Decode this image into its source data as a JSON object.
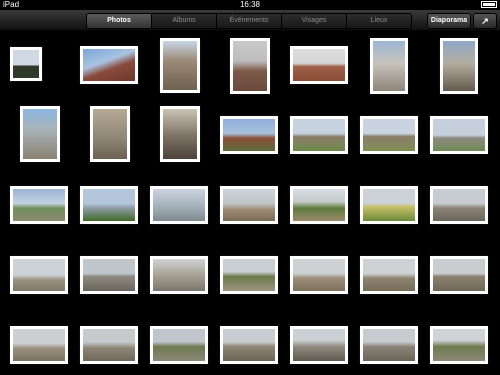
{
  "status": {
    "carrier_icon": "ipad-label",
    "carrier": "iPad",
    "time": "16:38",
    "battery_icon": "battery-icon"
  },
  "toolbar": {
    "tabs": [
      {
        "label": "Photos",
        "active": true
      },
      {
        "label": "Albums",
        "active": false
      },
      {
        "label": "Événements",
        "active": false
      },
      {
        "label": "Visages",
        "active": false
      },
      {
        "label": "Lieux",
        "active": false
      }
    ],
    "slideshow_label": "Diaporama",
    "share_icon": "share-icon",
    "share_glyph": "↗"
  },
  "photos": [
    {
      "bg": "linear-gradient(#cfd8e3 0%,#cfd8e3 55%,#2f3a2a 55%,#2f3a2a 100%)"
    },
    {
      "bg": "linear-gradient(160deg,#7aa6d6 0%,#a9c3e0 40%,#8a4a3a 60%,#6b3a2d 100%)"
    },
    {
      "bg": "linear-gradient(#c8d6e6 0%,#9c8a76 40%,#6f6150 100%)"
    },
    {
      "bg": "linear-gradient(#c9c9c9 0%,#bdbdbd 40%,#7d5a48 60%,#6a4a3b 100%)"
    },
    {
      "bg": "linear-gradient(#dcdcdc 0%,#d5d5d5 45%,#a06048 55%,#8b4d38 100%)"
    },
    {
      "bg": "linear-gradient(#9cb6d4 0%,#c7c3bb 45%,#8e857a 100%)"
    },
    {
      "bg": "linear-gradient(#8fa8c9 0%,#b3ad9f 45%,#625a4e 100%)"
    },
    {
      "bg": "linear-gradient(#8cb6e2 0%,#a7b3b9 40%,#8b8171 100%)"
    },
    {
      "bg": "linear-gradient(#b5aa96 0%,#8f8574 60%,#6b6152 100%)"
    },
    {
      "bg": "linear-gradient(#c9c3b3 0%,#7b7263 55%,#4b433a 100%)"
    },
    {
      "bg": "linear-gradient(#8fb0db 0%,#a8c0de 45%,#8a4f3a 60%,#5c6e3c 100%)"
    },
    {
      "bg": "linear-gradient(#c6d2df 0%,#c6d2df 45%,#8c7e6a 55%,#6e8a4c 100%)"
    },
    {
      "bg": "linear-gradient(#c9d4e0 0%,#c9d4e0 45%,#8c7e6a 55%,#7f8f52 100%)"
    },
    {
      "bg": "linear-gradient(#c6d0dc 0%,#c6d0dc 50%,#8d8a80 60%,#6f8a52 100%)"
    },
    {
      "bg": "linear-gradient(#9bb4d2 0%,#c3d2e2 45%,#6f8f5b 60%,#8d8a70 100%)"
    },
    {
      "bg": "linear-gradient(#b3c6dc 0%,#b3c6dc 45%,#8e9aa2 60%,#3e6a2a 100%)"
    },
    {
      "bg": "linear-gradient(#cbd4de 0%,#a8b4bd 50%,#7f8a8f 100%)"
    },
    {
      "bg": "linear-gradient(#cdd4dc 0%,#bfc4c6 45%,#9c8a72 65%,#7a6a55 100%)"
    },
    {
      "bg": "linear-gradient(#d6dde6 0%,#c3c9c5 40%,#5e7a3c 60%,#9c8a6e 100%)"
    },
    {
      "bg": "linear-gradient(#ccd2d8 0%,#ccd2d8 45%,#c9c16a 55%,#6b8a3a 100%)"
    },
    {
      "bg": "linear-gradient(#c6ccd2 0%,#c6ccd2 45%,#8a8273 60%,#6b665e 100%)"
    },
    {
      "bg": "linear-gradient(#cdd2d8 0%,#cdd2d8 50%,#9a9280 65%,#7e7868 100%)"
    },
    {
      "bg": "linear-gradient(#bfc6cc 0%,#bfc6cc 45%,#8e8a80 55%,#6a655c 100%)"
    },
    {
      "bg": "linear-gradient(#cfd3d6 0%,#a8a294 50%,#7a756b 100%)"
    },
    {
      "bg": "linear-gradient(#c9cfd5 0%,#c9cfd5 40%,#6b7a4c 55%,#9e9480 100%)"
    },
    {
      "bg": "linear-gradient(#cdd1d4 0%,#cdd1d4 45%,#9c8e78 60%,#7c705e 100%)"
    },
    {
      "bg": "linear-gradient(#cfd2d4 0%,#cfd2d4 45%,#8e8470 60%,#766c5a 100%)"
    },
    {
      "bg": "linear-gradient(#c9cdd0 0%,#c9cdd0 45%,#8a8070 55%,#6e6656 100%)"
    },
    {
      "bg": "linear-gradient(#ccd0d3 0%,#ccd0d3 45%,#9a907e 60%,#7b7261 100%)"
    },
    {
      "bg": "linear-gradient(#c6cacd 0%,#c6cacd 40%,#8b8476 60%,#6f685c 100%)"
    },
    {
      "bg": "linear-gradient(#c0c6cc 0%,#c0c6cc 40%,#6e7a52 55%,#8c8878 100%)"
    },
    {
      "bg": "linear-gradient(#c8cdd1 0%,#c8cdd1 40%,#8f8676 55%,#6a6356 100%)"
    },
    {
      "bg": "linear-gradient(#cbd0d4 0%,#cbd0d4 35%,#8e8a7e 55%,#5e5a50 100%)"
    },
    {
      "bg": "linear-gradient(#c8ccd0 0%,#c8ccd0 40%,#8a8478 55%,#6b655a 100%)"
    },
    {
      "bg": "linear-gradient(#cfd3d6 0%,#cfd3d6 35%,#6e7a4e 55%,#8d8777 100%)"
    },
    {
      "bg": "linear-gradient(#c9cdd1 0%,#c9cdd1 30%,#9a8f7e 50%,#726a5c 100%)"
    },
    {
      "bg": "linear-gradient(#d2d5d7 0%,#d2d5d7 40%,#8c8577 60%,#686254 100%)"
    },
    {
      "bg": "linear-gradient(#cdd1d5 0%,#cdd1d5 40%,#8d877a 55%,#6d675b 100%)"
    },
    {
      "bg": "linear-gradient(#c7cbcf 0%,#c7cbcf 40%,#6a7a4a 55%,#8a8474 100%)"
    },
    {
      "bg": "linear-gradient(#c3cdd8 0%,#c3cdd8 40%,#8b9aa8 55%,#3f5a2a 100%)"
    }
  ]
}
